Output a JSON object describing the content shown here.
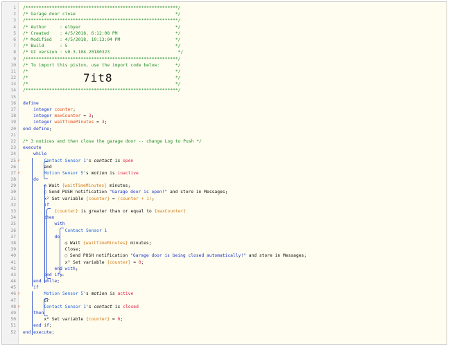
{
  "import_code": "7it8",
  "lines": [
    {
      "n": "1",
      "c": [
        [
          "cm",
          "/**********************************************************/"
        ]
      ]
    },
    {
      "n": "2",
      "c": [
        [
          "cm",
          "/* Garage door close                                      */"
        ]
      ]
    },
    {
      "n": "3",
      "c": [
        [
          "cm",
          "/**********************************************************/"
        ]
      ]
    },
    {
      "n": "4",
      "c": [
        [
          "cm",
          "/* Author     : elbyer                                    */"
        ]
      ]
    },
    {
      "n": "5",
      "c": [
        [
          "cm",
          "/* Created    : 4/5/2018, 6:12:08 PM                      */"
        ]
      ]
    },
    {
      "n": "6",
      "c": [
        [
          "cm",
          "/* Modified   : 4/5/2018, 10:13:04 PM                     */"
        ]
      ]
    },
    {
      "n": "7",
      "c": [
        [
          "cm",
          "/* Build      : 5                                         */"
        ]
      ]
    },
    {
      "n": "8",
      "c": [
        [
          "cm",
          "/* UI version : v0.3.104.20180323                          */"
        ]
      ]
    },
    {
      "n": "9",
      "c": [
        [
          "cm",
          "/**********************************************************/"
        ]
      ]
    },
    {
      "n": "10",
      "c": [
        [
          "cm",
          "/* To import this piston, use the import code below:      */"
        ]
      ]
    },
    {
      "n": "11",
      "c": [
        [
          "cm",
          "/*                                                        */"
        ]
      ]
    },
    {
      "n": "12",
      "c": [
        [
          "cm",
          "/*                                                        */"
        ]
      ]
    },
    {
      "n": "13",
      "c": [
        [
          "cm",
          "/*                                                        */"
        ]
      ]
    },
    {
      "n": "14",
      "c": [
        [
          "cm",
          "/**********************************************************/"
        ]
      ]
    },
    {
      "n": "15",
      "c": []
    },
    {
      "n": "16",
      "c": [
        [
          "kw",
          "define"
        ]
      ]
    },
    {
      "n": "17",
      "c": [
        [
          "tx",
          "    "
        ],
        [
          "ty",
          "integer "
        ],
        [
          "var",
          "counter"
        ],
        [
          "tx",
          ";"
        ]
      ]
    },
    {
      "n": "18",
      "c": [
        [
          "tx",
          "    "
        ],
        [
          "ty",
          "integer "
        ],
        [
          "var",
          "maxCounter"
        ],
        [
          "tx",
          " = "
        ],
        [
          "num",
          "3"
        ],
        [
          "tx",
          ";"
        ]
      ]
    },
    {
      "n": "19",
      "c": [
        [
          "tx",
          "    "
        ],
        [
          "ty",
          "integer "
        ],
        [
          "var",
          "waitTimeMinutes"
        ],
        [
          "tx",
          " = "
        ],
        [
          "num",
          "3"
        ],
        [
          "tx",
          ";"
        ]
      ]
    },
    {
      "n": "20",
      "c": [
        [
          "kw",
          "end define"
        ],
        [
          "tx",
          ";"
        ]
      ]
    },
    {
      "n": "21",
      "c": []
    },
    {
      "n": "22",
      "c": [
        [
          "cm",
          "/* 3 notices and then close the garage door -- change Log to Push */"
        ]
      ]
    },
    {
      "n": "23",
      "c": [
        [
          "kw",
          "execute"
        ]
      ]
    },
    {
      "n": "24",
      "c": [
        [
          "tx",
          "    "
        ],
        [
          "kw",
          "while"
        ]
      ]
    },
    {
      "n": "25",
      "f": true,
      "c": [
        [
          "tx",
          "        "
        ],
        [
          "dev",
          "Contact Sensor 1"
        ],
        [
          "tx",
          "'s "
        ],
        [
          "attr",
          "contact"
        ],
        [
          "tx",
          " is "
        ],
        [
          "val",
          "open"
        ]
      ]
    },
    {
      "n": "26",
      "c": [
        [
          "tx",
          "        "
        ],
        [
          "tx",
          "and"
        ]
      ]
    },
    {
      "n": "27",
      "f": true,
      "c": [
        [
          "tx",
          "        "
        ],
        [
          "dev",
          "Motion Sensor 5"
        ],
        [
          "tx",
          "'s "
        ],
        [
          "attr",
          "motion"
        ],
        [
          "tx",
          " is "
        ],
        [
          "val",
          "inactive"
        ]
      ]
    },
    {
      "n": "28",
      "c": [
        [
          "tx",
          "    "
        ],
        [
          "kw",
          "do"
        ]
      ]
    },
    {
      "n": "29",
      "c": [
        [
          "tx",
          "        "
        ],
        [
          "icon",
          "◷ "
        ],
        [
          "tx",
          "Wait "
        ],
        [
          "ex",
          "{waitTimeMinutes}"
        ],
        [
          "tx",
          " minutes;"
        ]
      ]
    },
    {
      "n": "30",
      "c": [
        [
          "tx",
          "        "
        ],
        [
          "icon",
          "▢ "
        ],
        [
          "tx",
          "Send PUSH notification "
        ],
        [
          "str",
          "\"Garage door is open!\""
        ],
        [
          "tx",
          " and store in Messages;"
        ]
      ]
    },
    {
      "n": "31",
      "c": [
        [
          "tx",
          "        "
        ],
        [
          "tx",
          "x² Set variable "
        ],
        [
          "ex",
          "{counter}"
        ],
        [
          "tx",
          " = "
        ],
        [
          "ex",
          "(counter + 1)"
        ],
        [
          "tx",
          ";"
        ]
      ]
    },
    {
      "n": "32",
      "c": [
        [
          "tx",
          "        "
        ],
        [
          "kw",
          "if"
        ]
      ]
    },
    {
      "n": "33",
      "c": [
        [
          "tx",
          "            "
        ],
        [
          "ex",
          "{counter}"
        ],
        [
          "tx",
          " is greater than or equal to "
        ],
        [
          "ex",
          "{maxCounter}"
        ]
      ]
    },
    {
      "n": "34",
      "c": [
        [
          "tx",
          "        "
        ],
        [
          "kw",
          "then"
        ]
      ]
    },
    {
      "n": "35",
      "c": [
        [
          "tx",
          "            "
        ],
        [
          "kw",
          "with"
        ]
      ]
    },
    {
      "n": "36",
      "c": [
        [
          "tx",
          "                "
        ],
        [
          "dev",
          "Contact Sensor 1"
        ]
      ]
    },
    {
      "n": "37",
      "c": [
        [
          "tx",
          "            "
        ],
        [
          "kw",
          "do"
        ]
      ]
    },
    {
      "n": "38",
      "c": [
        [
          "tx",
          "                "
        ],
        [
          "icon",
          "◷ "
        ],
        [
          "tx",
          "Wait "
        ],
        [
          "ex",
          "{waitTimeMinutes}"
        ],
        [
          "tx",
          " minutes;"
        ]
      ]
    },
    {
      "n": "39",
      "c": [
        [
          "tx",
          "                "
        ],
        [
          "tx",
          "Close;"
        ]
      ]
    },
    {
      "n": "40",
      "c": [
        [
          "tx",
          "                "
        ],
        [
          "icon",
          "▢ "
        ],
        [
          "tx",
          "Send PUSH notification "
        ],
        [
          "str",
          "\"Garage door is being closed automatically!\""
        ],
        [
          "tx",
          " and store in Messages;"
        ]
      ]
    },
    {
      "n": "41",
      "c": [
        [
          "tx",
          "                "
        ],
        [
          "tx",
          "x² Set variable "
        ],
        [
          "ex",
          "{counter}"
        ],
        [
          "tx",
          " = "
        ],
        [
          "num",
          "0"
        ],
        [
          "tx",
          ";"
        ]
      ]
    },
    {
      "n": "42",
      "c": [
        [
          "tx",
          "            "
        ],
        [
          "kw",
          "end with"
        ],
        [
          "tx",
          ";"
        ]
      ]
    },
    {
      "n": "43",
      "c": [
        [
          "tx",
          "        "
        ],
        [
          "kw",
          "end if"
        ],
        [
          "tx",
          ";"
        ]
      ]
    },
    {
      "n": "44",
      "c": [
        [
          "tx",
          "    "
        ],
        [
          "kw",
          "end while"
        ],
        [
          "tx",
          ";"
        ]
      ]
    },
    {
      "n": "45",
      "c": [
        [
          "tx",
          "    "
        ],
        [
          "kw",
          "if"
        ]
      ]
    },
    {
      "n": "46",
      "f": true,
      "c": [
        [
          "tx",
          "        "
        ],
        [
          "dev",
          "Motion Sensor 5"
        ],
        [
          "tx",
          "'s "
        ],
        [
          "attr",
          "motion"
        ],
        [
          "tx",
          " is "
        ],
        [
          "val",
          "active"
        ]
      ]
    },
    {
      "n": "47",
      "c": [
        [
          "tx",
          "        "
        ],
        [
          "tx",
          "or"
        ]
      ]
    },
    {
      "n": "48",
      "f": true,
      "c": [
        [
          "tx",
          "        "
        ],
        [
          "dev",
          "Contact Sensor 1"
        ],
        [
          "tx",
          "'s "
        ],
        [
          "attr",
          "contact"
        ],
        [
          "tx",
          " is "
        ],
        [
          "val",
          "closed"
        ]
      ]
    },
    {
      "n": "49",
      "c": [
        [
          "tx",
          "    "
        ],
        [
          "kw",
          "then"
        ]
      ]
    },
    {
      "n": "50",
      "c": [
        [
          "tx",
          "        "
        ],
        [
          "tx",
          "x² Set variable "
        ],
        [
          "ex",
          "{counter}"
        ],
        [
          "tx",
          " = "
        ],
        [
          "num",
          "0"
        ],
        [
          "tx",
          ";"
        ]
      ]
    },
    {
      "n": "51",
      "c": [
        [
          "tx",
          "    "
        ],
        [
          "kw",
          "end if"
        ],
        [
          "tx",
          ";"
        ]
      ]
    },
    {
      "n": "52",
      "c": [
        [
          "kw",
          "end execute"
        ],
        [
          "tx",
          ";"
        ]
      ]
    }
  ],
  "colors": {
    "background": "#fffdf0",
    "comment": "#1b8a26",
    "keyword": "#1a36c7",
    "variable": "#e44a1a",
    "flag": "#e25b1b"
  }
}
